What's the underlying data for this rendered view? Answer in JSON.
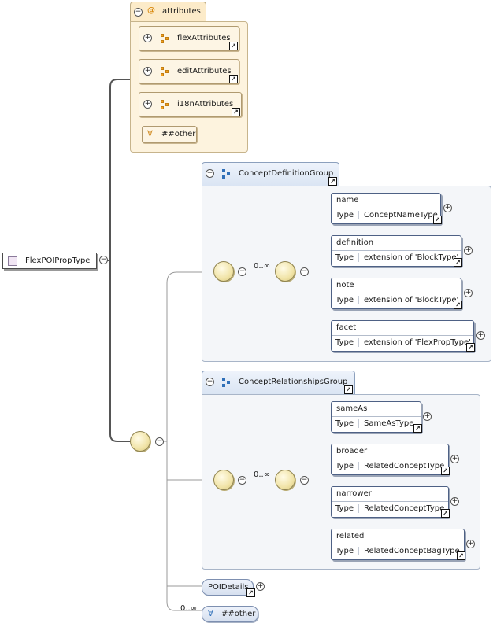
{
  "root": {
    "label": "FlexPOIPropType"
  },
  "attributes": {
    "label": "attributes",
    "items": [
      {
        "label": "flexAttributes"
      },
      {
        "label": "editAttributes"
      },
      {
        "label": "i18nAttributes"
      }
    ],
    "any_label": "##other"
  },
  "group1": {
    "label": "ConceptDefinitionGroup",
    "multiplicity": "0..∞",
    "type_label": "Type",
    "elements": [
      {
        "name": "name",
        "type": "ConceptNameType"
      },
      {
        "name": "definition",
        "type": "extension of 'BlockType'"
      },
      {
        "name": "note",
        "type": "extension of 'BlockType'"
      },
      {
        "name": "facet",
        "type": "extension of 'FlexPropType'"
      }
    ]
  },
  "group2": {
    "label": "ConceptRelationshipsGroup",
    "multiplicity": "0..∞",
    "type_label": "Type",
    "elements": [
      {
        "name": "sameAs",
        "type": "SameAsType"
      },
      {
        "name": "broader",
        "type": "RelatedConceptType"
      },
      {
        "name": "narrower",
        "type": "RelatedConceptType"
      },
      {
        "name": "related",
        "type": "RelatedConceptBagType"
      }
    ]
  },
  "poi_details": {
    "label": "POIDetails"
  },
  "any_other": {
    "label": "##other",
    "multiplicity": "0..∞"
  }
}
